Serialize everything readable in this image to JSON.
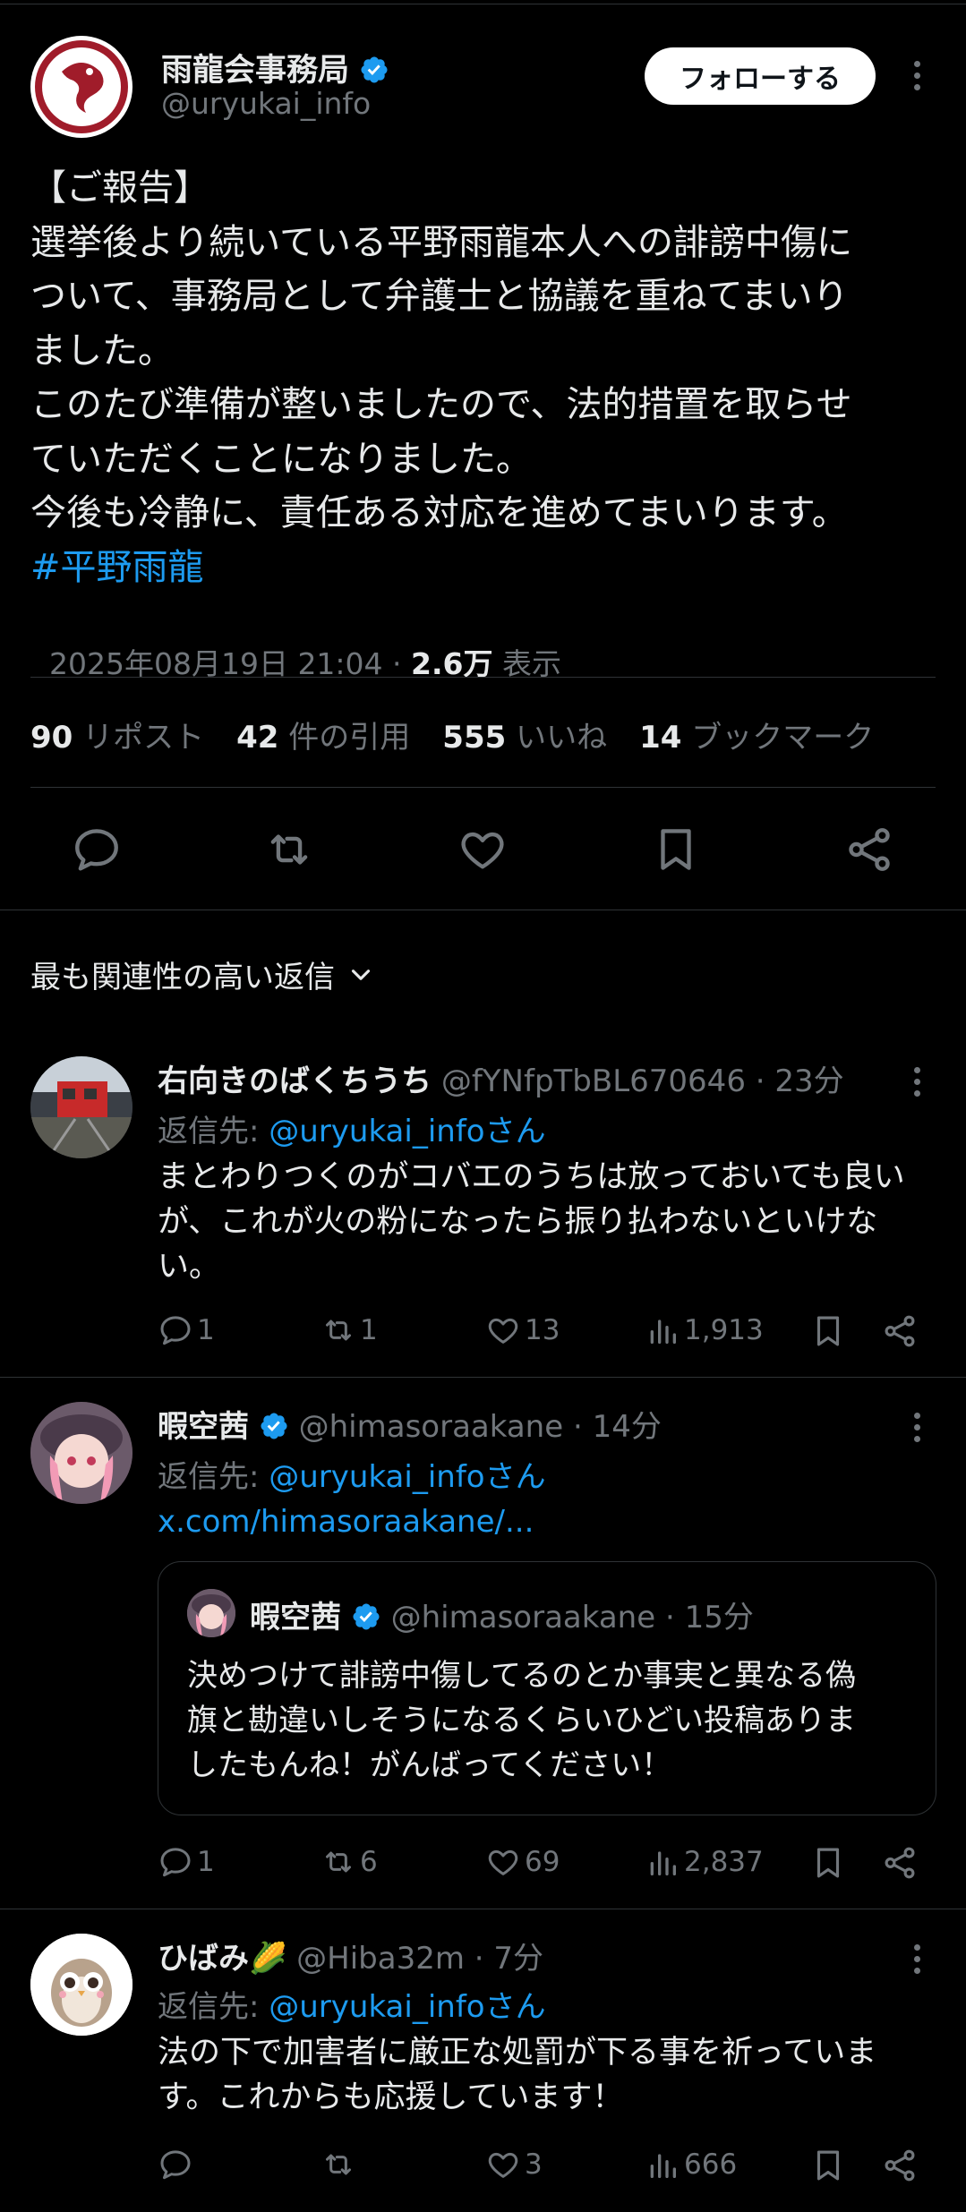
{
  "main_tweet": {
    "display_name": "雨龍会事務局",
    "handle": "@uryukai_info",
    "follow_label": "フォローする",
    "body_lines": [
      "【ご報告】",
      "選挙後より続いている平野雨龍本人への誹謗中傷に",
      "ついて、事務局として弁護士と協議を重ねてまいり",
      "ました。",
      "このたび準備が整いましたので、法的措置を取らせ",
      "ていただくことになりました。",
      "今後も冷静に、責任ある対応を進めてまいります。"
    ],
    "hashtag": "#平野雨龍",
    "timestamp": "2025年08月19日 21:04",
    "separator": " · ",
    "views_count": "2.6万",
    "views_label": "表示",
    "stats": [
      {
        "count": "90",
        "label": "リポスト"
      },
      {
        "count": "42",
        "label": "件の引用"
      },
      {
        "count": "555",
        "label": "いいね"
      },
      {
        "count": "14",
        "label": "ブックマーク"
      }
    ]
  },
  "sort_label": "最も関連性の高い返信",
  "replies": [
    {
      "display_name": "右向きのばくちうち",
      "handle": "@fYNfpTbBL670646",
      "time": "· 23分",
      "reply_to_prefix": "返信先: ",
      "reply_to_handle": "@uryukai_infoさん",
      "body_lines": [
        "まとわりつくのがコバエのうちは放っておいても良い",
        "が、これが火の粉になったら振り払わないといけな",
        "い。"
      ],
      "reply_count": "1",
      "repost_count": "1",
      "like_count": "13",
      "view_count": "1,913"
    },
    {
      "display_name": "暇空茜",
      "handle": "@himasoraakane",
      "time": "· 14分",
      "reply_to_prefix": "返信先: ",
      "reply_to_handle": "@uryukai_infoさん",
      "link": "x.com/himasoraakane/...",
      "quote": {
        "display_name": "暇空茜",
        "handle": "@himasoraakane",
        "time": "· 15分",
        "body_lines": [
          "決めつけて誹謗中傷してるのとか事実と異なる偽",
          "旗と勘違いしそうになるくらいひどい投稿ありま",
          "したもんね！がんばってください！"
        ]
      },
      "reply_count": "1",
      "repost_count": "6",
      "like_count": "69",
      "view_count": "2,837"
    },
    {
      "display_name": "ひばみ🌽",
      "handle": "@Hiba32m",
      "time": "· 7分",
      "reply_to_prefix": "返信先: ",
      "reply_to_handle": "@uryukai_infoさん",
      "body_lines": [
        "法の下で加害者に厳正な処罰が下る事を祈っていま",
        "す。これからも応援しています！"
      ],
      "reply_count": "",
      "repost_count": "",
      "like_count": "3",
      "view_count": "666"
    }
  ],
  "colors": {
    "background": "#000000",
    "text": "#e7e9ea",
    "muted": "#71767b",
    "link": "#1d9bf0",
    "divider": "#2f3336",
    "verified": "#1d9bf0",
    "follow_bg": "#ffffff"
  }
}
